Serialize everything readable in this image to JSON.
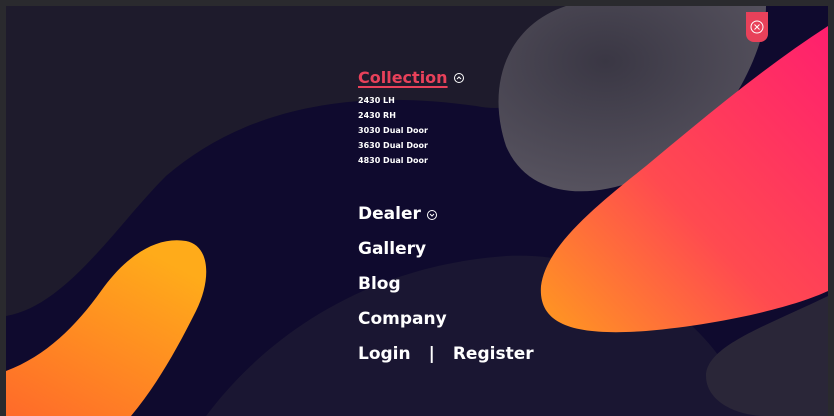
{
  "menu": {
    "collection": {
      "title": "Collection",
      "items": [
        "2430 LH",
        "2430 RH",
        "3030 Dual Door",
        "3630 Dual Door",
        "4830 Dual Door"
      ]
    },
    "dealer": "Dealer",
    "gallery": "Gallery",
    "blog": "Blog",
    "company": "Company",
    "login": "Login",
    "separator": "|",
    "register": "Register"
  },
  "icons": {
    "collection_toggle": "chevron-up-icon",
    "dealer_toggle": "chevron-down-icon",
    "close": "close-icon"
  },
  "colors": {
    "background": "#0f0a2e",
    "accent": "#e8415a",
    "gradient_pink": "#ff1f6e",
    "gradient_orange": "#ff9a1f"
  }
}
